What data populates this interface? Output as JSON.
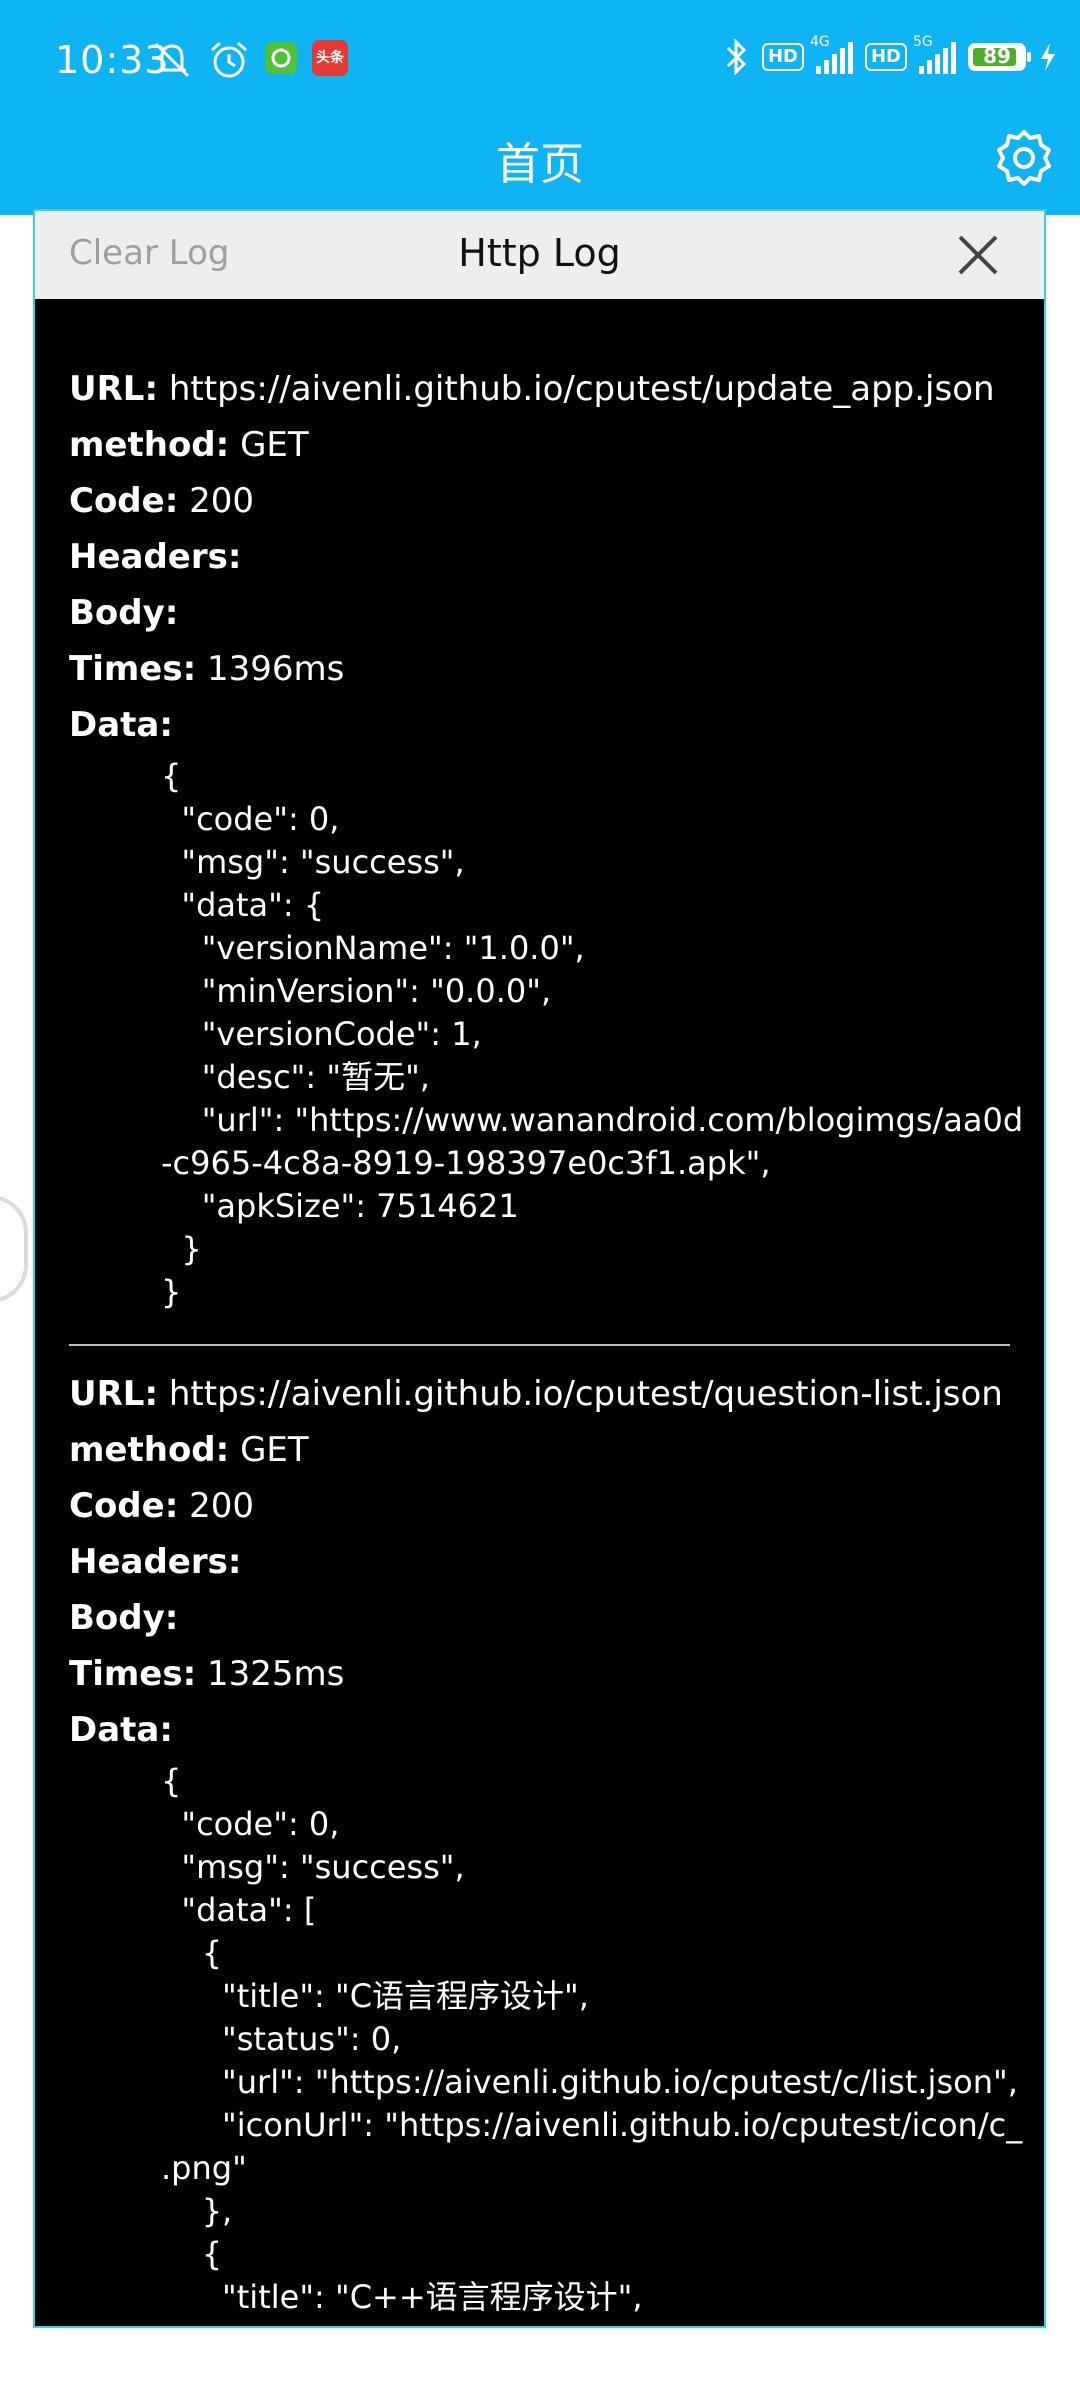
{
  "status_bar": {
    "time": "10:33",
    "icons_left": [
      "mute-icon",
      "alarm-icon",
      "app-notify-icon",
      "toutiao-icon"
    ],
    "toutiao_label": "头条",
    "hd1": "HD",
    "net1": "4G",
    "hd2": "HD",
    "net2": "5G",
    "battery": "89",
    "battery_fill": 0.89
  },
  "app_bar": {
    "title": "首页"
  },
  "dialog": {
    "clear_label": "Clear Log",
    "title": "Http Log"
  },
  "labels": {
    "url": "URL:",
    "method": "method:",
    "code": "Code:",
    "headers": "Headers:",
    "body": "Body:",
    "times": "Times:",
    "data": "Data:"
  },
  "logs": [
    {
      "url": "https://aivenli.github.io/cputest/update_app.json",
      "method": "GET",
      "code": "200",
      "headers": "",
      "body": "",
      "times": "1396ms",
      "data": "{\n  \"code\": 0,\n  \"msg\": \"success\",\n  \"data\": {\n    \"versionName\": \"1.0.0\",\n    \"minVersion\": \"0.0.0\",\n    \"versionCode\": 1,\n    \"desc\": \"暂无\",\n    \"url\": \"https://www.wanandroid.com/blogimgs/aa0d\n-c965-4c8a-8919-198397e0c3f1.apk\",\n    \"apkSize\": 7514621\n  }\n}"
    },
    {
      "url": "https://aivenli.github.io/cputest/question-list.json",
      "method": "GET",
      "code": "200",
      "headers": "",
      "body": "",
      "times": "1325ms",
      "data": "{\n  \"code\": 0,\n  \"msg\": \"success\",\n  \"data\": [\n    {\n      \"title\": \"C语言程序设计\",\n      \"status\": 0,\n      \"url\": \"https://aivenli.github.io/cputest/c/list.json\",\n      \"iconUrl\": \"https://aivenli.github.io/cputest/icon/c_\n.png\"\n    },\n    {\n      \"title\": \"C++语言程序设计\","
    }
  ]
}
